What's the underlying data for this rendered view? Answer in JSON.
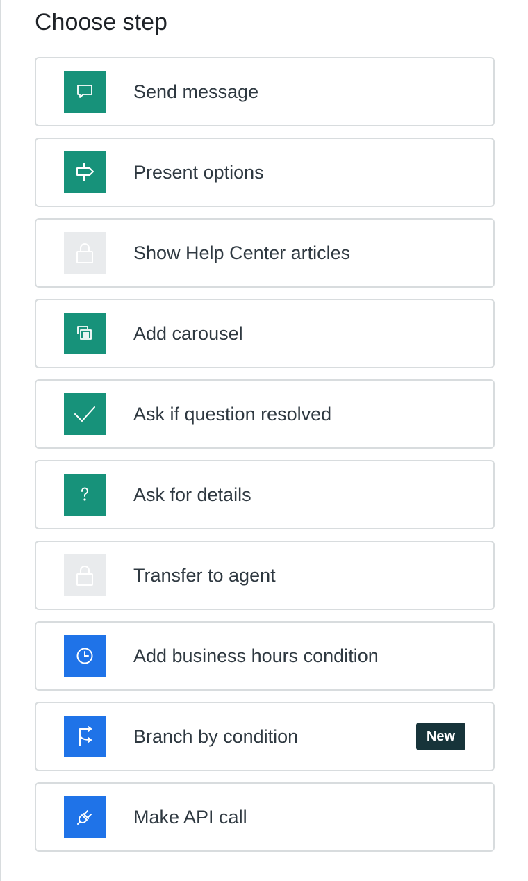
{
  "header": {
    "title": "Choose step"
  },
  "steps": [
    {
      "label": "Send message",
      "icon": "chat-bubble-icon",
      "icon_color": "#17927a",
      "locked": false
    },
    {
      "label": "Present options",
      "icon": "signpost-icon",
      "icon_color": "#17927a",
      "locked": false
    },
    {
      "label": "Show Help Center articles",
      "icon": "lock-icon",
      "icon_color": "#e9ebed",
      "locked": true
    },
    {
      "label": "Add carousel",
      "icon": "carousel-icon",
      "icon_color": "#17927a",
      "locked": false
    },
    {
      "label": "Ask if question resolved",
      "icon": "checkmark-icon",
      "icon_color": "#17927a",
      "locked": false
    },
    {
      "label": "Ask for details",
      "icon": "question-mark-icon",
      "icon_color": "#17927a",
      "locked": false
    },
    {
      "label": "Transfer to agent",
      "icon": "lock-icon",
      "icon_color": "#e9ebed",
      "locked": true
    },
    {
      "label": "Add business hours condition",
      "icon": "clock-icon",
      "icon_color": "#1f73e8",
      "locked": false
    },
    {
      "label": "Branch by condition",
      "icon": "branch-icon",
      "icon_color": "#1f73e8",
      "locked": false,
      "badge": "New"
    },
    {
      "label": "Make API call",
      "icon": "plug-icon",
      "icon_color": "#1f73e8",
      "locked": false
    }
  ]
}
